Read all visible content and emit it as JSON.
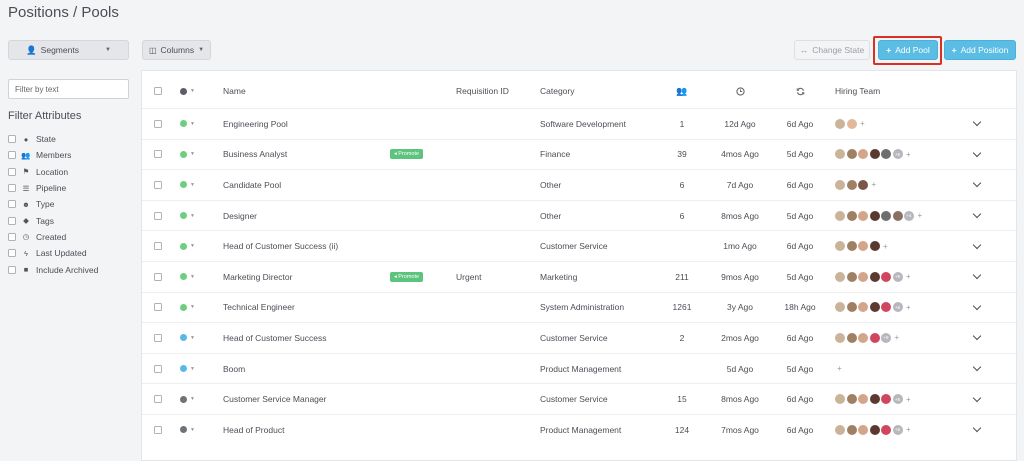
{
  "page": {
    "title": "Positions / Pools"
  },
  "toolbar": {
    "segments_label": "Segments",
    "columns_label": "Columns",
    "change_state_label": "Change State",
    "add_pool_label": "Add Pool",
    "add_position_label": "Add Position"
  },
  "sidebar": {
    "filter_placeholder": "Filter by text",
    "filter_heading": "Filter Attributes",
    "items": [
      {
        "label": "State",
        "icon": "circle-icon"
      },
      {
        "label": "Members",
        "icon": "users-icon"
      },
      {
        "label": "Location",
        "icon": "location-pin-icon"
      },
      {
        "label": "Pipeline",
        "icon": "list-icon"
      },
      {
        "label": "Type",
        "icon": "user-circle-icon"
      },
      {
        "label": "Tags",
        "icon": "tag-icon"
      },
      {
        "label": "Created",
        "icon": "clock-icon"
      },
      {
        "label": "Last Updated",
        "icon": "bolt-icon"
      },
      {
        "label": "Include Archived",
        "icon": "archive-icon"
      }
    ]
  },
  "table": {
    "columns": {
      "name": "Name",
      "requisition": "Requisition ID",
      "category": "Category",
      "hiring_team": "Hiring Team"
    },
    "badge_label": "Promote",
    "rows": [
      {
        "name": "Engineering Pool",
        "badge": false,
        "req": "",
        "category": "Software Development",
        "members": "1",
        "created": "12d Ago",
        "updated": "6d Ago",
        "status": "#6ccf7f",
        "avatars": [
          "#c9b49a",
          "#e3b89a"
        ],
        "more": ""
      },
      {
        "name": "Business Analyst",
        "badge": true,
        "req": "",
        "category": "Finance",
        "members": "39",
        "created": "4mos Ago",
        "updated": "5d Ago",
        "status": "#6ccf7f",
        "avatars": [
          "#c9b49a",
          "#a08064",
          "#d4a58a",
          "#5a3a30",
          "#6e6e6e"
        ],
        "more": "+8"
      },
      {
        "name": "Candidate Pool",
        "badge": false,
        "req": "",
        "category": "Other",
        "members": "6",
        "created": "7d Ago",
        "updated": "6d Ago",
        "status": "#6ccf7f",
        "avatars": [
          "#c9b49a",
          "#a08064",
          "#7a5848"
        ],
        "more": ""
      },
      {
        "name": "Designer",
        "badge": false,
        "req": "",
        "category": "Other",
        "members": "6",
        "created": "8mos Ago",
        "updated": "5d Ago",
        "status": "#6ccf7f",
        "avatars": [
          "#c9b49a",
          "#a08064",
          "#d4a58a",
          "#5a3a30",
          "#6e6e6e",
          "#8a7060"
        ],
        "more": "+4"
      },
      {
        "name": "Head of Customer Success (ii)",
        "badge": false,
        "req": "",
        "category": "Customer Service",
        "members": "",
        "created": "1mo Ago",
        "updated": "6d Ago",
        "status": "#6ccf7f",
        "avatars": [
          "#c9b49a",
          "#a08064",
          "#d4a58a",
          "#5a3a30"
        ],
        "more": ""
      },
      {
        "name": "Marketing Director",
        "badge": true,
        "req": "Urgent",
        "category": "Marketing",
        "members": "211",
        "created": "9mos Ago",
        "updated": "5d Ago",
        "status": "#6ccf7f",
        "avatars": [
          "#c9b49a",
          "#a08064",
          "#d4a58a",
          "#5a3a30",
          "#d0465e"
        ],
        "more": "+8"
      },
      {
        "name": "Technical Engineer",
        "badge": false,
        "req": "",
        "category": "System Administration",
        "members": "1261",
        "created": "3y Ago",
        "updated": "18h Ago",
        "status": "#6ccf7f",
        "avatars": [
          "#c9b49a",
          "#a08064",
          "#d4a58a",
          "#5a3a30",
          "#d0465e"
        ],
        "more": "+8"
      },
      {
        "name": "Head of Customer Success",
        "badge": false,
        "req": "",
        "category": "Customer Service",
        "members": "2",
        "created": "2mos Ago",
        "updated": "6d Ago",
        "status": "#5bb8e6",
        "avatars": [
          "#c9b49a",
          "#a08064",
          "#d4a58a",
          "#d0465e"
        ],
        "more": "+8"
      },
      {
        "name": "Boom",
        "badge": false,
        "req": "",
        "category": "Product Management",
        "members": "",
        "created": "5d Ago",
        "updated": "5d Ago",
        "status": "#5bb8e6",
        "avatars": [],
        "more": ""
      },
      {
        "name": "Customer Service Manager",
        "badge": false,
        "req": "",
        "category": "Customer Service",
        "members": "15",
        "created": "8mos Ago",
        "updated": "6d Ago",
        "status": "#6e7378",
        "avatars": [
          "#c9b49a",
          "#a08064",
          "#d4a58a",
          "#5a3a30",
          "#d0465e"
        ],
        "more": "+8"
      },
      {
        "name": "Head of Product",
        "badge": false,
        "req": "",
        "category": "Product Management",
        "members": "124",
        "created": "7mos Ago",
        "updated": "6d Ago",
        "status": "#6e7378",
        "avatars": [
          "#c9b49a",
          "#a08064",
          "#d4a58a",
          "#5a3a30",
          "#d0465e"
        ],
        "more": "+8"
      }
    ]
  }
}
